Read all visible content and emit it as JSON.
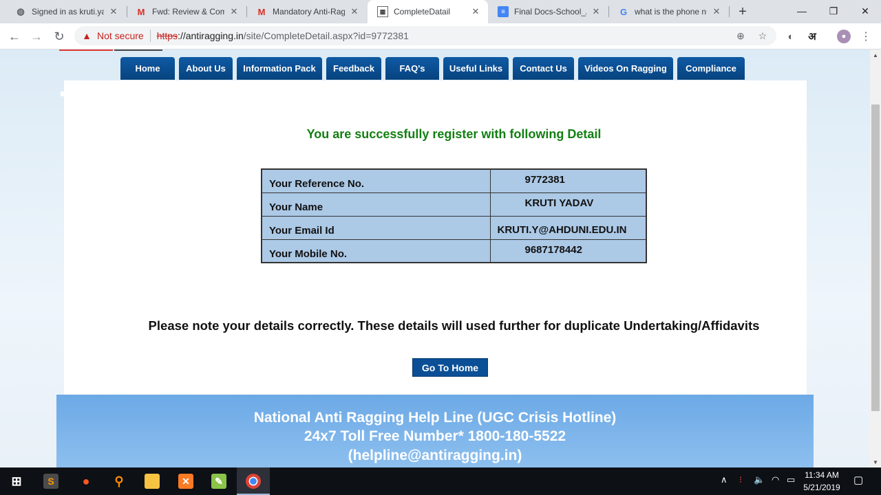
{
  "tabs": [
    {
      "title": "Signed in as kruti.ya",
      "icon": "shield-icon"
    },
    {
      "title": "Fwd: Review & Comn",
      "icon": "gmail-icon"
    },
    {
      "title": "Mandatory Anti-Rag",
      "icon": "gmail-icon"
    },
    {
      "title": "CompleteDatail",
      "icon": "site-logo-icon"
    },
    {
      "title": "Final Docs-School_A",
      "icon": "google-docs-icon"
    },
    {
      "title": "what is the phone nu",
      "icon": "google-icon"
    }
  ],
  "toolbar": {
    "not_secure": "Not secure",
    "url_scheme": "https",
    "url_host": "://antiragging.in",
    "url_path": "/site/CompleteDetail.aspx?id=9772381",
    "profile_char": "अ"
  },
  "nav": [
    "Home",
    "About Us",
    "Information Pack",
    "Feedback",
    "FAQ's",
    "Useful Links",
    "Contact Us",
    "Videos On Ragging",
    "Compliance"
  ],
  "content": {
    "success_message": "You are successfully register with following Detail",
    "details": [
      {
        "label": "Your Reference No.",
        "value": "9772381"
      },
      {
        "label": "Your Name",
        "value": "KRUTI YADAV"
      },
      {
        "label": "Your Email Id",
        "value": "KRUTI.Y@AHDUNI.EDU.IN"
      },
      {
        "label": "Your Mobile No.",
        "value": "9687178442"
      }
    ],
    "note": "Please note your details correctly. These details will used further for duplicate Undertaking/Affidavits",
    "go_home_label": "Go To Home"
  },
  "footer": {
    "line1": "National Anti Ragging Help Line (UGC Crisis Hotline)",
    "line2": "24x7 Toll Free Number* 1800-180-5522",
    "line3": "(helpline@antiragging.in)"
  },
  "taskbar": {
    "time": "11:34 AM",
    "date": "5/21/2019"
  },
  "colors": {
    "nav_blue": "#0b4f96",
    "success_green": "#127f12",
    "table_fill": "#acc9e6",
    "footer_blue": "#7db5ea"
  }
}
